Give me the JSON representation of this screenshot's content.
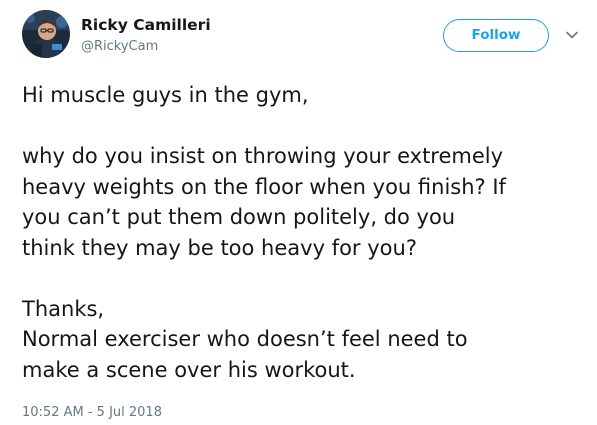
{
  "author": {
    "name": "Ricky Camilleri",
    "handle": "@RickyCam"
  },
  "actions": {
    "follow_label": "Follow",
    "menu_icon": "chevron-down-icon"
  },
  "tweet": {
    "lines": [
      "Hi muscle guys in the gym,",
      "",
      "why do you insist on throwing your extremely",
      "heavy weights on the floor when you finish? If",
      "you can’t put them down politely, do you",
      "think they may be too heavy for you?",
      "",
      "Thanks,",
      "Normal exerciser who doesn’t feel need to",
      "make a scene over his workout."
    ]
  },
  "meta": {
    "timestamp": "10:52 AM - 5 Jul 2018"
  },
  "colors": {
    "accent": "#1da1f2",
    "text": "#14171a",
    "secondary": "#657786"
  }
}
